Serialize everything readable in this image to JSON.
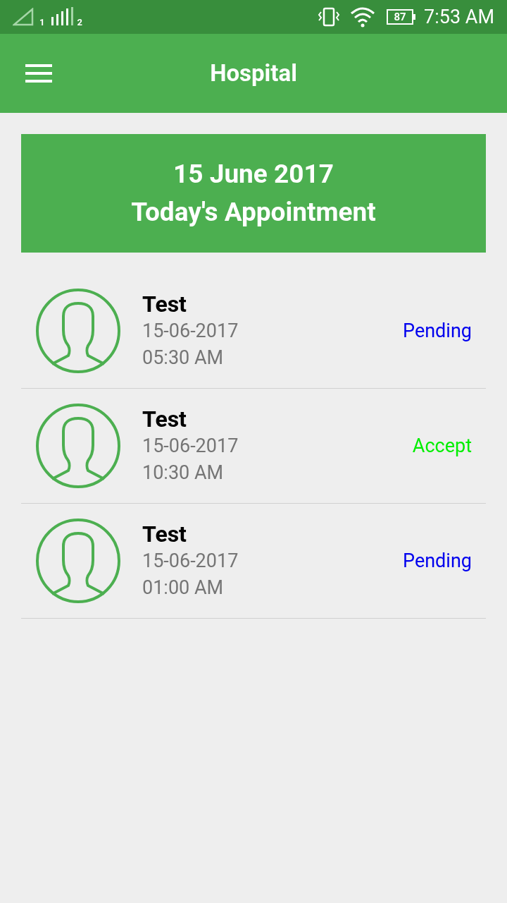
{
  "status_bar": {
    "sim1": "1",
    "sim2": "2",
    "battery": "87",
    "time": "7:53 AM"
  },
  "app_bar": {
    "title": "Hospital"
  },
  "banner": {
    "date": "15 June 2017",
    "title": "Today's Appointment"
  },
  "appointments": [
    {
      "name": "Test",
      "date": "15-06-2017",
      "time": "05:30 AM",
      "status": "Pending",
      "color": "#0000ee"
    },
    {
      "name": "Test",
      "date": "15-06-2017",
      "time": "10:30 AM",
      "status": "Accept",
      "color": "#00ee00"
    },
    {
      "name": "Test",
      "date": "15-06-2017",
      "time": "01:00 AM",
      "status": "Pending",
      "color": "#0000ee"
    }
  ]
}
